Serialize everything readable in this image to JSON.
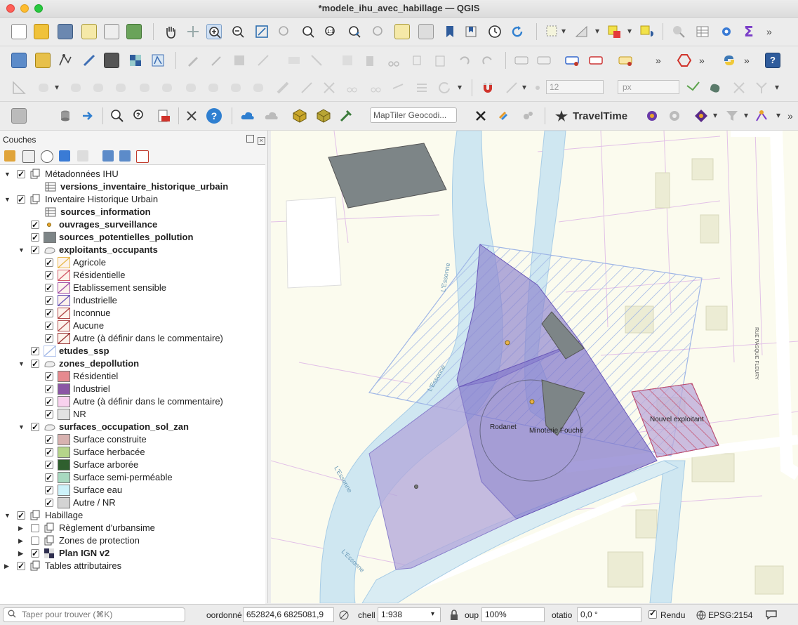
{
  "window": {
    "title": "*modele_ihu_avec_habillage — QGIS"
  },
  "toolbar": {
    "geocoder_placeholder": "MapTiler Geocodi...",
    "traveltime_label": "TravelTime",
    "snapping_tolerance": "12",
    "snapping_unit": "px",
    "overflow_chevron": "»"
  },
  "layers_panel": {
    "title": "Couches",
    "items": [
      {
        "label": "Métadonnées IHU",
        "level": 0,
        "checked": true,
        "expanded": true,
        "kind": "group",
        "bold": false
      },
      {
        "label": "versions_inventaire_historique_urbain",
        "level": 1,
        "checked": null,
        "kind": "table",
        "bold": true
      },
      {
        "label": "Inventaire Historique Urbain",
        "level": 0,
        "checked": true,
        "expanded": true,
        "kind": "group",
        "bold": false
      },
      {
        "label": "sources_information",
        "level": 1,
        "checked": null,
        "kind": "table",
        "bold": true
      },
      {
        "label": "ouvrages_surveillance",
        "level": 1,
        "checked": true,
        "kind": "point",
        "bold": true
      },
      {
        "label": "sources_potentielles_pollution",
        "level": 1,
        "checked": true,
        "kind": "fill",
        "color": "#7d8587",
        "bold": true
      },
      {
        "label": "exploitants_occupants",
        "level": 1,
        "checked": true,
        "expanded": true,
        "kind": "polygon-layer",
        "bold": true
      },
      {
        "label": "Agricole",
        "level": 2,
        "checked": true,
        "kind": "hatch",
        "color": "#e8b94d"
      },
      {
        "label": "Résidentielle",
        "level": 2,
        "checked": true,
        "kind": "hatch",
        "color": "#d35a6a"
      },
      {
        "label": "Etablissement sensible",
        "level": 2,
        "checked": true,
        "kind": "hatch",
        "color": "#a14fa6"
      },
      {
        "label": "Industrielle",
        "level": 2,
        "checked": true,
        "kind": "hatch",
        "color": "#6a58b8"
      },
      {
        "label": "Inconnue",
        "level": 2,
        "checked": true,
        "kind": "hatch",
        "color": "#b04848"
      },
      {
        "label": "Aucune",
        "level": 2,
        "checked": true,
        "kind": "hatch",
        "color": "#b35050"
      },
      {
        "label": "Autre (à définir dans le commentaire)",
        "level": 2,
        "checked": true,
        "kind": "hatch",
        "color": "#9a3434"
      },
      {
        "label": "etudes_ssp",
        "level": 1,
        "checked": true,
        "kind": "hatch-light",
        "color": "#9fb6e6",
        "bold": true
      },
      {
        "label": "zones_depollution",
        "level": 1,
        "checked": true,
        "expanded": true,
        "kind": "polygon-layer",
        "bold": true
      },
      {
        "label": "Résidentiel",
        "level": 2,
        "checked": true,
        "kind": "fill",
        "color": "#e68a8f"
      },
      {
        "label": "Industriel",
        "level": 2,
        "checked": true,
        "kind": "fill",
        "color": "#8a56a4"
      },
      {
        "label": "Autre (à définir dans le commentaire)",
        "level": 2,
        "checked": true,
        "kind": "fill",
        "color": "#f8d1ee"
      },
      {
        "label": "NR",
        "level": 2,
        "checked": true,
        "kind": "fill",
        "color": "#e3e3e3"
      },
      {
        "label": "surfaces_occupation_sol_zan",
        "level": 1,
        "checked": true,
        "expanded": true,
        "kind": "polygon-layer",
        "bold": true
      },
      {
        "label": "Surface construite",
        "level": 2,
        "checked": true,
        "kind": "fill",
        "color": "#d8b2b0"
      },
      {
        "label": "Surface herbacée",
        "level": 2,
        "checked": true,
        "kind": "fill",
        "color": "#b5d48a"
      },
      {
        "label": "Surface arborée",
        "level": 2,
        "checked": true,
        "kind": "fill",
        "color": "#2f5f2e"
      },
      {
        "label": "Surface semi-perméable",
        "level": 2,
        "checked": true,
        "kind": "fill",
        "color": "#a8d9c0"
      },
      {
        "label": "Surface eau",
        "level": 2,
        "checked": true,
        "kind": "fill",
        "color": "#cdf2fa"
      },
      {
        "label": "Autre / NR",
        "level": 2,
        "checked": true,
        "kind": "fill",
        "color": "#d3d3d3"
      },
      {
        "label": "Habillage",
        "level": 0,
        "checked": true,
        "expanded": true,
        "kind": "group",
        "bold": false
      },
      {
        "label": "Règlement d'urbansime",
        "level": 1,
        "checked": false,
        "expanded": false,
        "kind": "group",
        "bold": false
      },
      {
        "label": "Zones de protection",
        "level": 1,
        "checked": false,
        "expanded": false,
        "kind": "group",
        "bold": false
      },
      {
        "label": "Plan IGN v2",
        "level": 1,
        "checked": true,
        "expanded": false,
        "kind": "raster",
        "bold": true,
        "underline": true
      },
      {
        "label": "Tables attributaires",
        "level": 0,
        "checked": true,
        "expanded": false,
        "kind": "group",
        "bold": false
      }
    ]
  },
  "map": {
    "labels": {
      "rodanet": "Rodanet",
      "minoterie": "Minoterie Fouché",
      "nouvel_exploitant": "Nouvel exploitant",
      "river_1": "L'Essonne",
      "river_2": "L'Essonne",
      "river_3": "L'Essonne",
      "river_4": "L'Essonne",
      "street": "RUE PASQUE FLEURY"
    }
  },
  "statusbar": {
    "search_placeholder": "Taper pour trouver (⌘K)",
    "coordinate_label": "oordonné",
    "coordinate_value": "652824,6 6825081,9",
    "scale_label": "chell",
    "scale_value": "1:938",
    "magnifier_label": "oup",
    "magnifier_value": "100%",
    "rotation_label": "otatio",
    "rotation_value": "0,0 °",
    "render_label": "Rendu",
    "render_checked": true,
    "crs": "EPSG:2154"
  },
  "colors": {
    "pollution_fill": "#7d8587",
    "zone_industrielle": "#8a80cc",
    "etude_hatch": "#9fb6e6",
    "water": "#cfe7f1"
  }
}
